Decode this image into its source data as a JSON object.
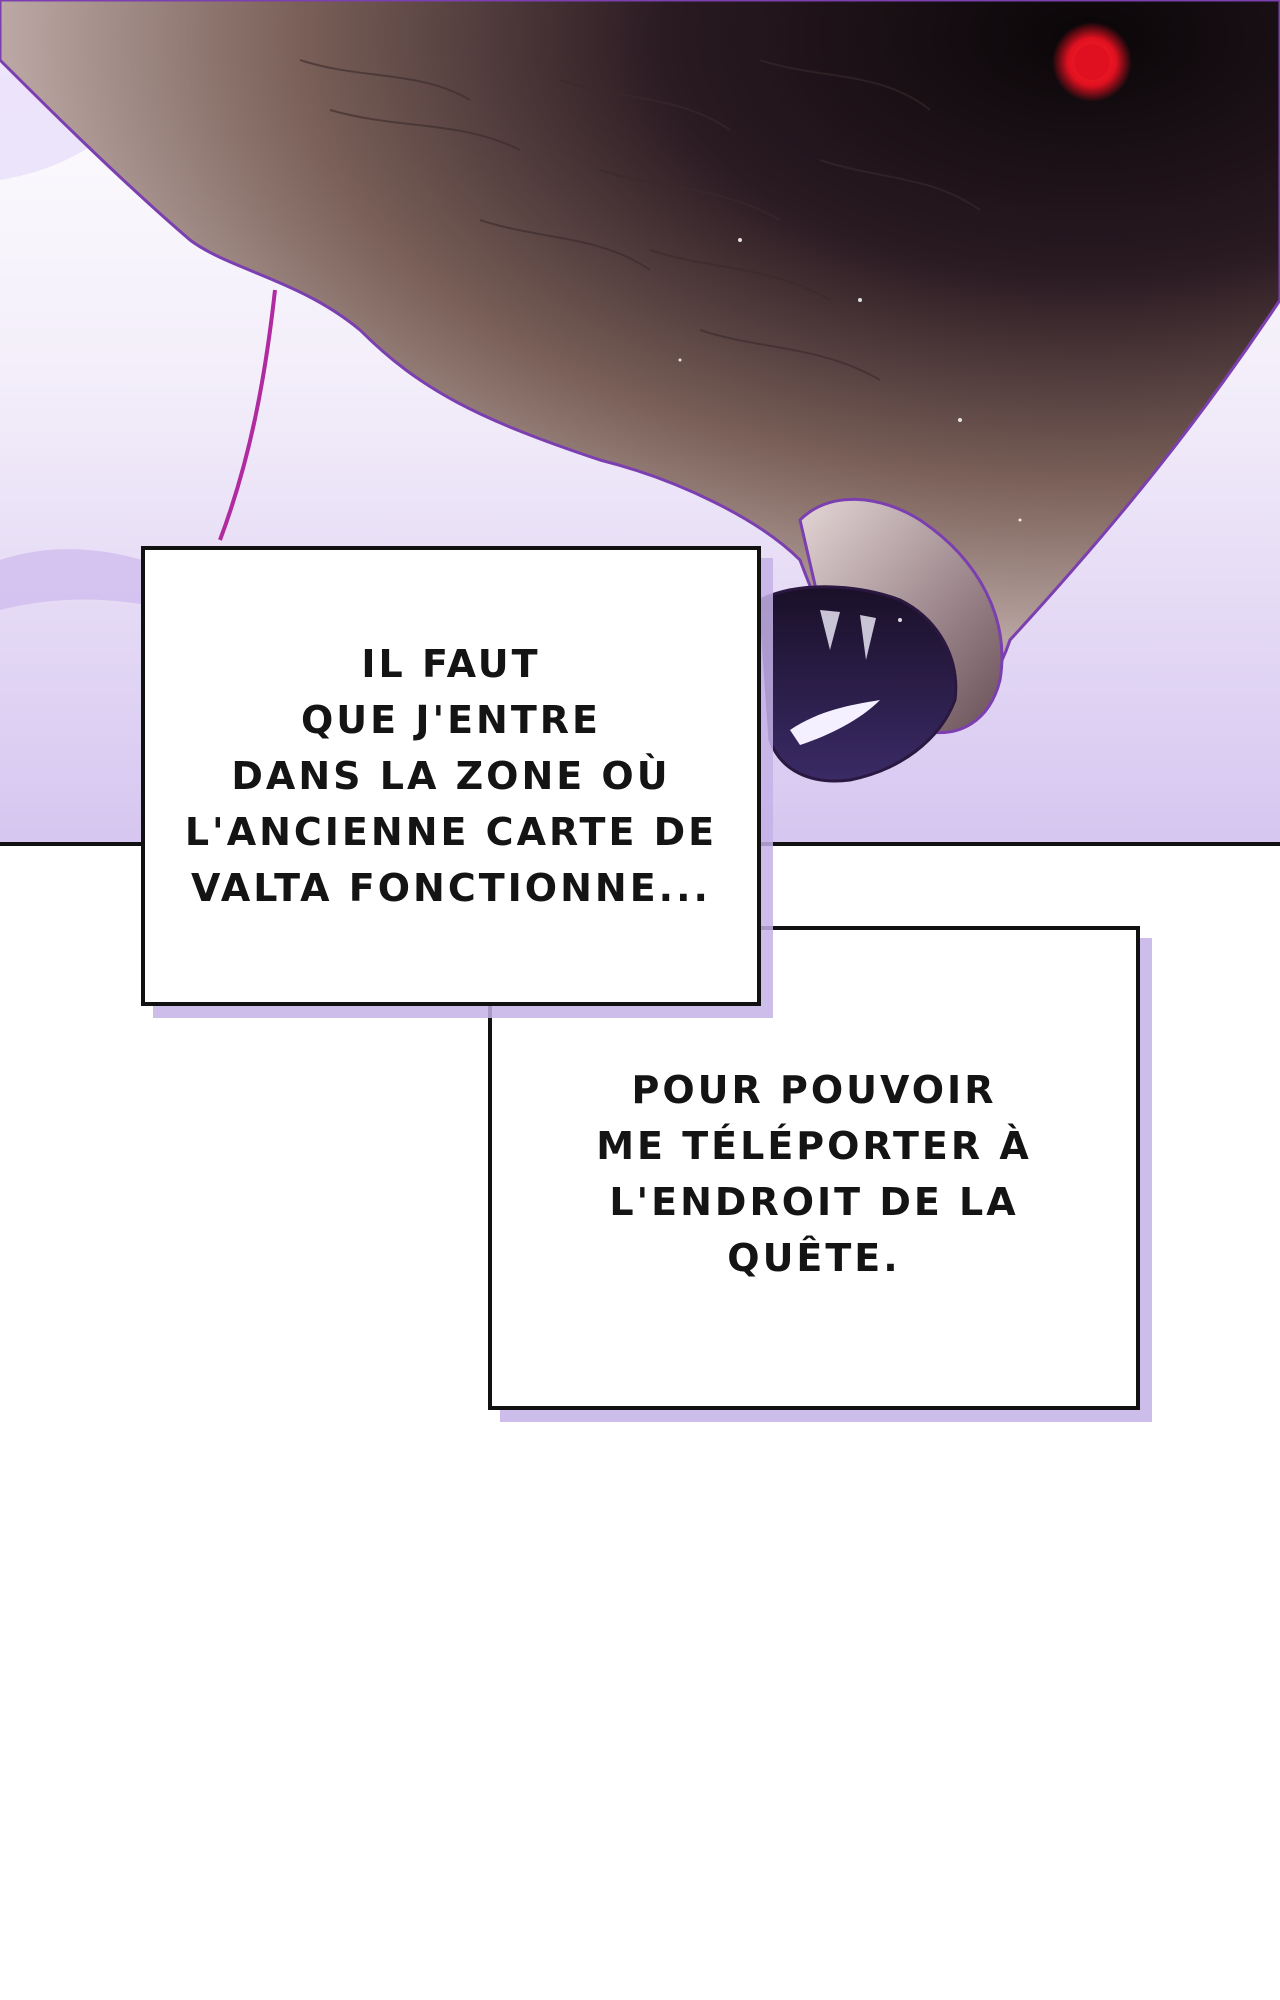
{
  "panel": {
    "eye_color": "#e01020",
    "glow_color": "#c9b6ee"
  },
  "captions": [
    {
      "text": "IL FAUT\nQUE J'ENTRE\nDANS LA ZONE OÙ\nL'ANCIENNE CARTE DE\nVALTA FONCTIONNE..."
    },
    {
      "text": "POUR POUVOIR\nME TÉLÉPORTER À\nL'ENDROIT DE LA\nQUÊTE."
    }
  ]
}
